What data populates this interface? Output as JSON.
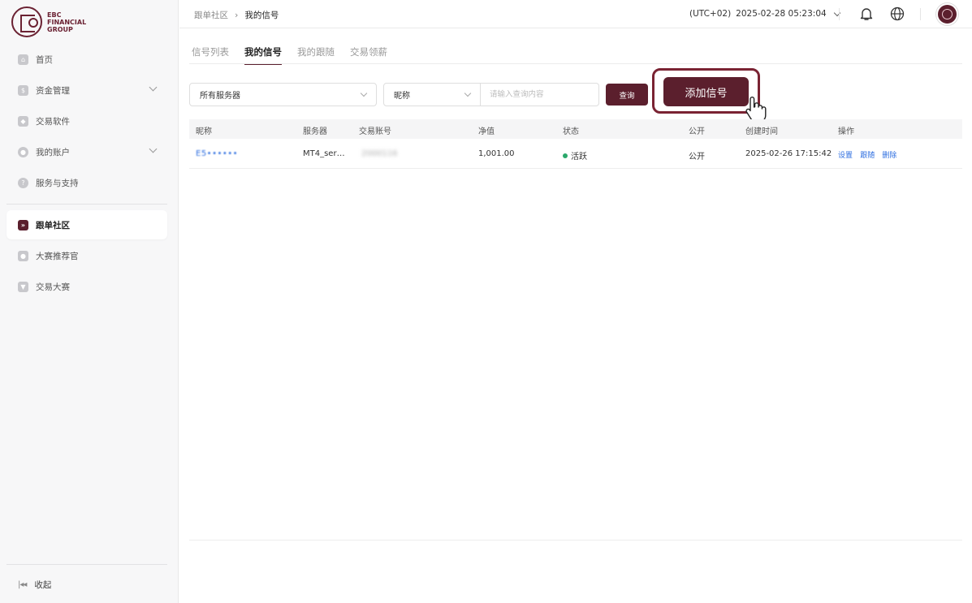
{
  "logo": {
    "line1": "EBC",
    "line2": "FINANCIAL",
    "line3": "GROUP"
  },
  "sidebar": {
    "items": [
      {
        "label": "首页",
        "icon": "home-icon"
      },
      {
        "label": "资金管理",
        "icon": "wallet-icon"
      },
      {
        "label": "交易软件",
        "icon": "cube-icon"
      },
      {
        "label": "我的账户",
        "icon": "user-icon"
      },
      {
        "label": "服务与支持",
        "icon": "help-icon"
      },
      {
        "label": "跟单社区",
        "icon": "copy-trade-icon"
      },
      {
        "label": "大赛推荐官",
        "icon": "badge-icon"
      },
      {
        "label": "交易大赛",
        "icon": "trophy-icon"
      }
    ],
    "collapse_label": "收起"
  },
  "header": {
    "breadcrumb_parent": "跟单社区",
    "breadcrumb_current": "我的信号",
    "timezone": "(UTC+02)",
    "datetime": "2025-02-28 05:23:04"
  },
  "tabs": [
    {
      "label": "信号列表"
    },
    {
      "label": "我的信号"
    },
    {
      "label": "我的跟随"
    },
    {
      "label": "交易领薪"
    }
  ],
  "filters": {
    "server_select": "所有服务器",
    "field_select": "昵称",
    "search_placeholder": "请输入查询内容",
    "query_label": "查询",
    "add_signal_label": "添加信号"
  },
  "table": {
    "columns": [
      "昵称",
      "服务器",
      "交易账号",
      "净值",
      "状态",
      "公开",
      "创建时间",
      "操作"
    ],
    "rows": [
      {
        "nickname": "E5••••••",
        "server": "MT4_ser…",
        "account": "2000116",
        "equity": "1,001.00",
        "status": "活跃",
        "public": "公开",
        "created": "2025-02-26 17:15:42",
        "ops": [
          "设置",
          "跟随",
          "删除"
        ]
      }
    ]
  },
  "colors": {
    "brand": "#5b1f2d",
    "link": "#2f6fe0",
    "status_active": "#2aa86b"
  }
}
